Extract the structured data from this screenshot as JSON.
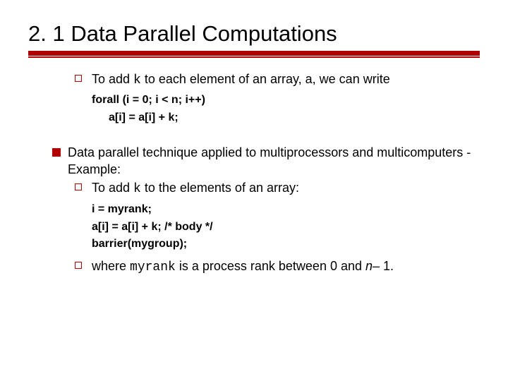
{
  "title": "2. 1 Data Parallel Computations",
  "item1": {
    "prefix": "To add ",
    "k": "k",
    "suffix": " to each element of an array, a, we can write"
  },
  "code1": {
    "line1": "forall (i = 0; i < n; i++)",
    "line2": "a[i] = a[i] + k;"
  },
  "item2": {
    "text": "Data parallel technique applied to multiprocessors and multicomputers - Example:"
  },
  "item2sub": {
    "prefix": "To add ",
    "k": "k",
    "suffix": " to the elements of an array:"
  },
  "code2": {
    "line1": "i = myrank;",
    "line2": "a[i] = a[i] + k; /* body */",
    "line3": "barrier(mygroup);"
  },
  "item3": {
    "prefix": "where ",
    "myrank": "myrank",
    "mid": " is a process rank between 0 and ",
    "n": "n",
    "suffix": "– 1."
  }
}
